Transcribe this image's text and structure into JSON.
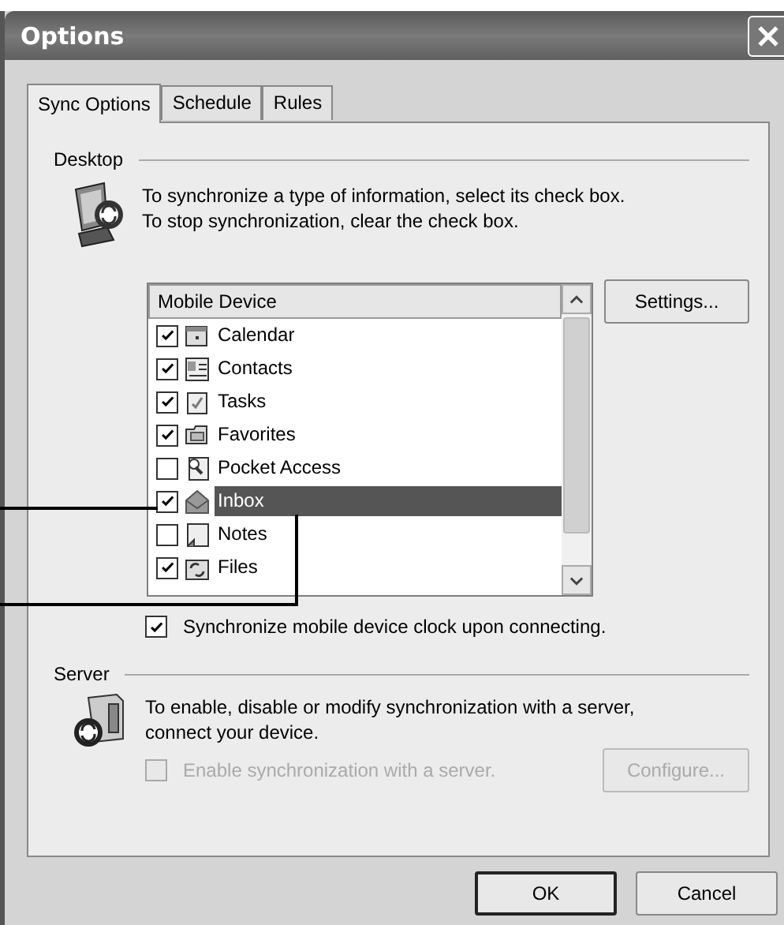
{
  "window": {
    "title": "Options"
  },
  "tabs": [
    {
      "label": "Sync Options",
      "selected": true
    },
    {
      "label": "Schedule",
      "selected": false
    },
    {
      "label": "Rules",
      "selected": false
    }
  ],
  "desktop": {
    "label": "Desktop",
    "description": [
      "To synchronize a type of information, select its check box.",
      "To stop synchronization, clear the check box."
    ],
    "list": {
      "column": "Mobile Device",
      "items": [
        {
          "label": "Calendar",
          "checked": true,
          "selected": false
        },
        {
          "label": "Contacts",
          "checked": true,
          "selected": false
        },
        {
          "label": "Tasks",
          "checked": true,
          "selected": false
        },
        {
          "label": "Favorites",
          "checked": true,
          "selected": false
        },
        {
          "label": "Pocket Access",
          "checked": false,
          "selected": false
        },
        {
          "label": "Inbox",
          "checked": true,
          "selected": true
        },
        {
          "label": "Notes",
          "checked": false,
          "selected": false
        },
        {
          "label": "Files",
          "checked": true,
          "selected": false
        }
      ]
    },
    "settings_button": "Settings..."
  },
  "clock_sync": {
    "label": "Synchronize mobile device clock upon connecting.",
    "checked": true
  },
  "server": {
    "label": "Server",
    "description": [
      "To enable, disable or modify synchronization with a server,",
      "connect your device."
    ],
    "enable": {
      "label": "Enable synchronization with a server.",
      "checked": false,
      "disabled": true
    },
    "configure_button": {
      "label": "Configure...",
      "disabled": true
    }
  },
  "buttons": [
    {
      "label": "OK",
      "default": true
    },
    {
      "label": "Cancel",
      "default": false
    }
  ]
}
